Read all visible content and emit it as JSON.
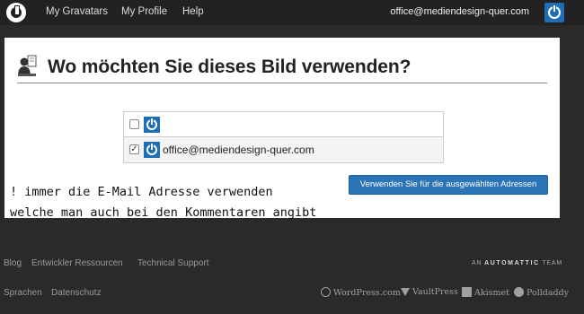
{
  "topbar": {
    "nav": [
      "My Gravatars",
      "My Profile",
      "Help"
    ],
    "user_email": "office@mediendesign-quer.com"
  },
  "main": {
    "heading": "Wo möchten Sie dieses Bild verwenden?",
    "addresses": [
      {
        "checked": false,
        "email": ""
      },
      {
        "checked": true,
        "email": "office@mediendesign-quer.com"
      }
    ],
    "use_button_label": "Verwenden Sie für die ausgewählten Adressen"
  },
  "annotation": [
    "! immer die E-Mail Adresse verwenden",
    "welche man auch bei den Kommentaren angibt"
  ],
  "footer": {
    "links_row1": [
      "Blog",
      "Entwickler Ressourcen",
      "Technical Support"
    ],
    "links_row2": [
      "Sprachen",
      "Datenschutz"
    ],
    "team_prefix": "AN",
    "team_brand": "AUTOMATTIC",
    "team_suffix": "TEAM",
    "partners": [
      "WordPress.com",
      "VaultPress",
      "Akismet",
      "Polldaddy"
    ]
  },
  "colors": {
    "accent": "#2b74b6",
    "topbar_bg": "#222222",
    "footer_bg": "#2a2a2a"
  },
  "icons": {
    "brand": "gravatar-logo-icon",
    "heading": "profile-picture-icon",
    "checkbox_checked": "✓"
  }
}
